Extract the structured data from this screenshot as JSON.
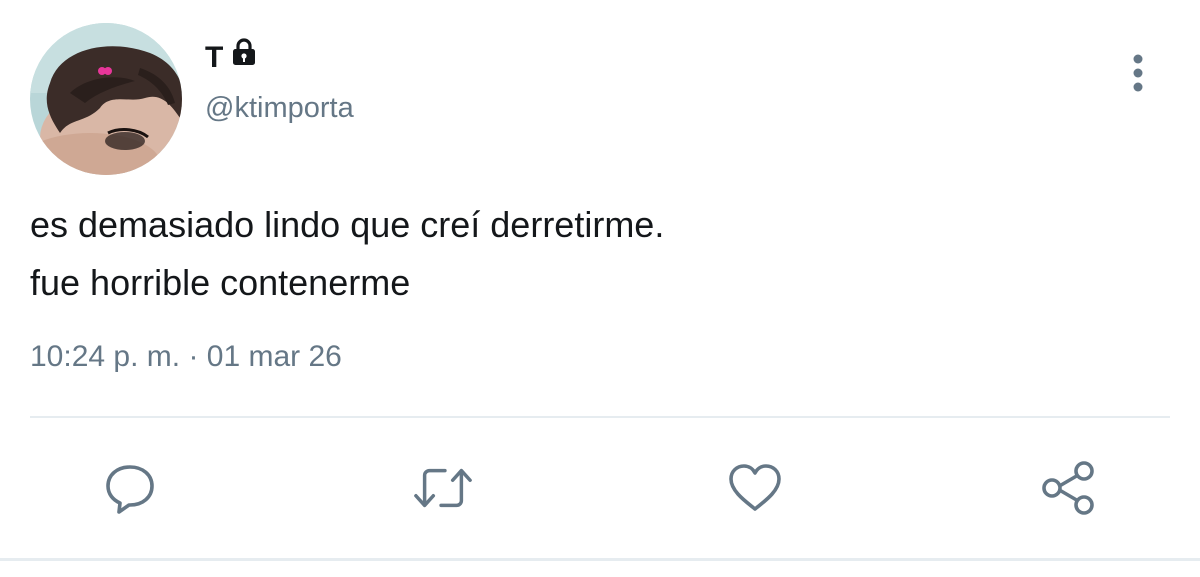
{
  "user": {
    "display_name": "T",
    "handle": "@ktimporta",
    "avatar_icon": "profile-photo",
    "lock_icon": "lock-icon"
  },
  "tweet": {
    "lines": [
      "es demasiado lindo que creí derretirme.",
      "fue horrible contenerme"
    ],
    "time": "10:24 p. m.",
    "separator": "·",
    "date": "01 mar 26"
  },
  "actions": {
    "reply_icon": "comment-icon",
    "retweet_icon": "retweet-icon",
    "like_icon": "heart-icon",
    "share_icon": "share-icon",
    "more_icon": "more-vertical-icon"
  },
  "colors": {
    "text_primary": "#14171a",
    "text_secondary": "#657786",
    "icon": "#657786",
    "divider": "#e6ecf0"
  }
}
